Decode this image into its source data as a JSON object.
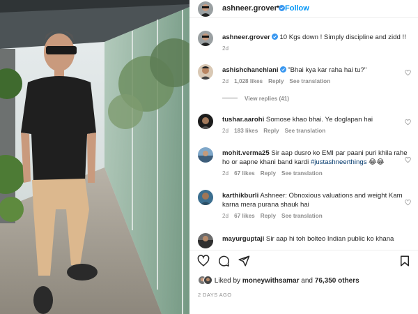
{
  "post": {
    "author": "ashneer.grover",
    "separator": "•",
    "follow_label": "Follow",
    "caption": "10 Kgs down ! Simply discipline and zidd !!",
    "caption_age": "2d"
  },
  "comments": [
    {
      "user": "ashishchanchlani",
      "verified": true,
      "text": "\"Bhai kya kar raha hai tu?\"",
      "age": "2d",
      "likes": "1,028 likes",
      "reply": "Reply",
      "translate": "See translation",
      "view_replies": "View replies (41)"
    },
    {
      "user": "tushar.aarohi",
      "verified": false,
      "text": "Somose khao bhai. Ye doglapan hai",
      "age": "2d",
      "likes": "183 likes",
      "reply": "Reply",
      "translate": "See translation"
    },
    {
      "user": "mohit.verma25",
      "verified": false,
      "text": "Sir aap dusro ko EMI par paani puri khila rahe ho or aapne khani band kardi",
      "hashtag": "#justashneerthings",
      "emoji": "😂😂",
      "age": "2d",
      "likes": "67 likes",
      "reply": "Reply",
      "translate": "See translation"
    },
    {
      "user": "karthikburli",
      "verified": false,
      "text": "Ashneer: Obnoxious valuations and weight Kam karna mera purana shauk hai",
      "age": "2d",
      "likes": "67 likes",
      "reply": "Reply",
      "translate": "See translation"
    },
    {
      "user": "mayurguptaji",
      "verified": false,
      "text": "Sir aap hi toh bolteo Indian public ko khana"
    }
  ],
  "likes_summary": {
    "prefix": "Liked by",
    "user": "moneywithsamar",
    "middle": "and",
    "count": "76,350 others"
  },
  "timestamp": "2 DAYS AGO",
  "colors": {
    "accent": "#0095f6",
    "verified": "#3897f0",
    "muted": "#8e8e8e"
  }
}
